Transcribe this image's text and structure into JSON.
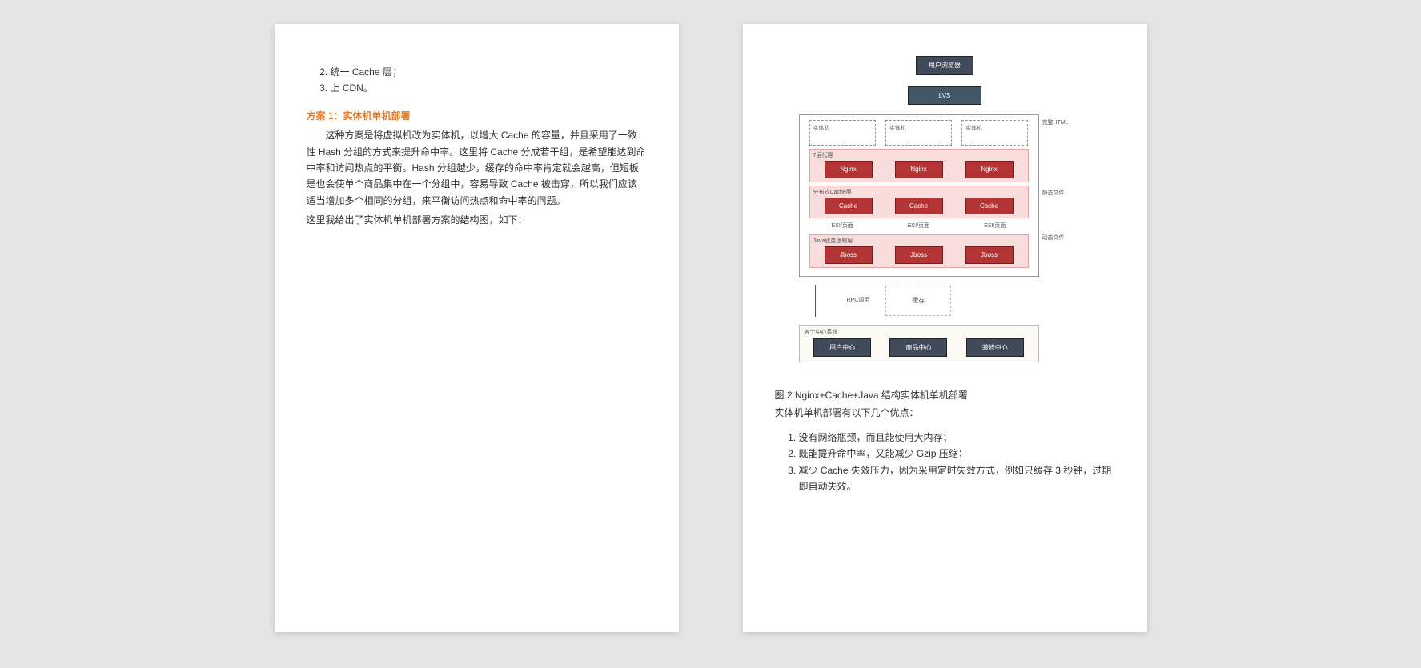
{
  "left": {
    "list_items": [
      "统一 Cache 层；",
      "上 CDN。"
    ],
    "list_start": 2,
    "heading": "方案 1：实体机单机部署",
    "p1": "这种方案是将虚拟机改为实体机，以增大 Cache 的容量，并且采用了一致性 Hash 分组的方式来提升命中率。这里将 Cache 分成若干组，是希望能达到命中率和访问热点的平衡。Hash 分组越少，缓存的命中率肯定就会越高，但短板是也会使单个商品集中在一个分组中，容易导致 Cache 被击穿，所以我们应该适当增加多个相同的分组，来平衡访问热点和命中率的问题。",
    "p2": "这里我给出了实体机单机部署方案的结构图，如下："
  },
  "diagram": {
    "top": "用户浏览器",
    "lvs": "LVS",
    "machine_group_label": "实体机",
    "proxy_layer_label": "7层代理",
    "proxy_box": "Nginx",
    "cache_layer_label": "分布式Cache层",
    "cache_box": "Cache",
    "esi_label": "ESI/页面",
    "java_layer_label": "Java业务逻辑层",
    "java_box": "Jboss",
    "side_html": "完整HTML",
    "side_static": "静态文件",
    "side_dynamic": "动态文件",
    "rpc": "RPC调用",
    "cache_dashed": "缓存",
    "bottom_label": "各个中心系统",
    "center1": "用户中心",
    "center2": "商品中心",
    "center3": "装修中心"
  },
  "right": {
    "caption": "图 2 Nginx+Cache+Java 结构实体机单机部署",
    "advantages_intro": "实体机单机部署有以下几个优点：",
    "adv": [
      "没有网络瓶颈，而且能使用大内存；",
      "既能提升命中率，又能减少 Gzip 压缩；",
      "减少 Cache 失效压力，因为采用定时失效方式，例如只缓存 3 秒钟，过期即自动失效。"
    ]
  }
}
